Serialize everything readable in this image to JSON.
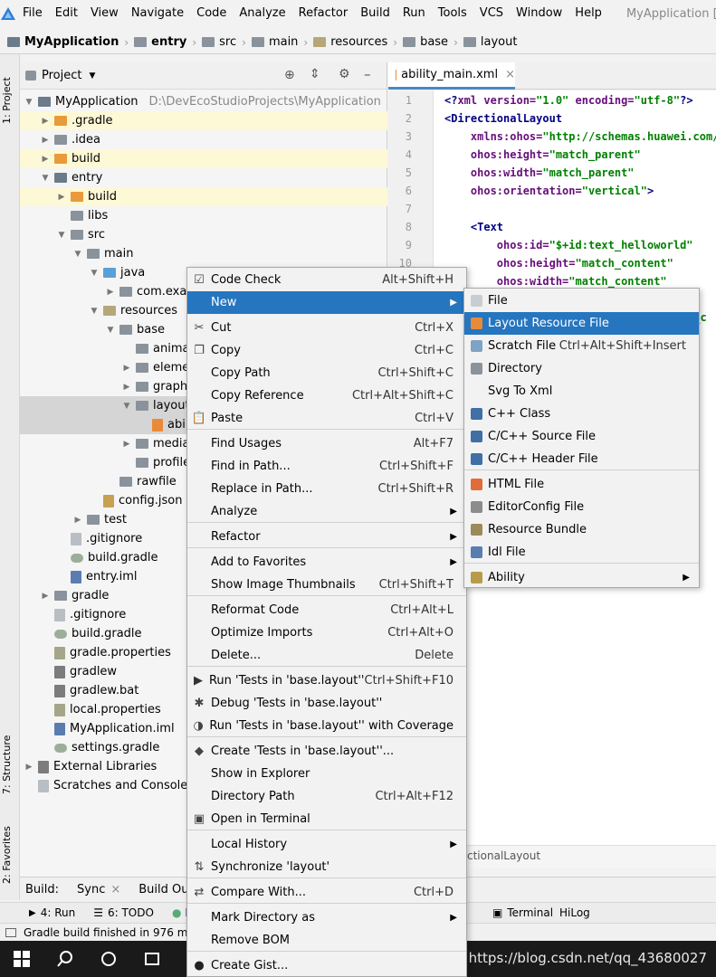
{
  "menubar": {
    "items": [
      "File",
      "Edit",
      "View",
      "Navigate",
      "Code",
      "Analyze",
      "Refactor",
      "Build",
      "Run",
      "Tools",
      "VCS",
      "Window",
      "Help"
    ],
    "window_title": "MyApplication ["
  },
  "breadcrumb": [
    "MyApplication",
    "entry",
    "src",
    "main",
    "resources",
    "base",
    "layout"
  ],
  "left_strip": {
    "project_tab": "1: Project",
    "structure_tab": "7: Structure",
    "favorites_tab": "2: Favorites"
  },
  "project_panel": {
    "title": "Project",
    "tree": [
      {
        "label": "MyApplication",
        "path": "D:\\DevEcoStudioProjects\\MyApplication"
      },
      {
        "label": ".gradle"
      },
      {
        "label": ".idea"
      },
      {
        "label": "build"
      },
      {
        "label": "entry"
      },
      {
        "label": "build"
      },
      {
        "label": "libs"
      },
      {
        "label": "src"
      },
      {
        "label": "main"
      },
      {
        "label": "java"
      },
      {
        "label": "com.exam"
      },
      {
        "label": "resources"
      },
      {
        "label": "base"
      },
      {
        "label": "animat"
      },
      {
        "label": "elemen"
      },
      {
        "label": "graphi"
      },
      {
        "label": "layout"
      },
      {
        "label": "abi"
      },
      {
        "label": "media"
      },
      {
        "label": "profile"
      },
      {
        "label": "rawfile"
      },
      {
        "label": "config.json"
      },
      {
        "label": "test"
      },
      {
        "label": ".gitignore"
      },
      {
        "label": "build.gradle"
      },
      {
        "label": "entry.iml"
      },
      {
        "label": "gradle"
      },
      {
        "label": ".gitignore"
      },
      {
        "label": "build.gradle"
      },
      {
        "label": "gradle.properties"
      },
      {
        "label": "gradlew"
      },
      {
        "label": "gradlew.bat"
      },
      {
        "label": "local.properties"
      },
      {
        "label": "MyApplication.iml"
      },
      {
        "label": "settings.gradle"
      },
      {
        "label": "External Libraries"
      },
      {
        "label": "Scratches and Consoles"
      }
    ]
  },
  "editor": {
    "tab": "ability_main.xml",
    "line_numbers": [
      "1",
      "2",
      "3",
      "4",
      "5",
      "6",
      "7",
      "8",
      "9",
      "10"
    ],
    "lines": [
      {
        "a": "<?",
        "b": "xml version=",
        "c": "\"1.0\"",
        "d": " encoding=",
        "e": "\"utf-8\"",
        "f": "?>"
      },
      {
        "a": "<DirectionalLayout",
        "b": "",
        "c": "",
        "d": "",
        "e": "",
        "f": ""
      },
      {
        "a": "    ",
        "b": "xmlns:ohos=",
        "c": "\"http://schemas.huawei.com/r",
        "d": "",
        "e": "",
        "f": ""
      },
      {
        "a": "    ",
        "b": "ohos:height=",
        "c": "\"match_parent\"",
        "d": "",
        "e": "",
        "f": ""
      },
      {
        "a": "    ",
        "b": "ohos:width=",
        "c": "\"match_parent\"",
        "d": "",
        "e": "",
        "f": ""
      },
      {
        "a": "    ",
        "b": "ohos:orientation=",
        "c": "\"vertical\"",
        "d": "",
        "e": "",
        "f": ">"
      },
      {
        "a": "",
        "b": "",
        "c": "",
        "d": "",
        "e": "",
        "f": ""
      },
      {
        "a": "    <Text",
        "b": "",
        "c": "",
        "d": "",
        "e": "",
        "f": ""
      },
      {
        "a": "        ",
        "b": "ohos:id=",
        "c": "\"$+id:text_helloworld\"",
        "d": "",
        "e": "",
        "f": ""
      },
      {
        "a": "        ",
        "b": "ohos:height=",
        "c": "\"match_content\"",
        "d": "",
        "e": "",
        "f": ""
      },
      {
        "a": "        ",
        "b": "ohos:width=",
        "c": "\"match_content\"",
        "d": "",
        "e": "",
        "f": ""
      }
    ],
    "partial_1": ":b",
    "partial_2": "l_c",
    "footer": "ctionalLayout"
  },
  "build_bar": {
    "label": "Build:",
    "sync": "Sync",
    "output": "Build Outp"
  },
  "bottom_bar": {
    "run": "4: Run",
    "todo": "6: TODO",
    "b": "B",
    "terminal": "Terminal",
    "hilog": "HiLog"
  },
  "status": "Gradle build finished in 976 ms",
  "watermark": "https://blog.csdn.net/qq_43680027",
  "context_menu": [
    {
      "label": "Code Check",
      "shortcut": "Alt+Shift+H"
    },
    {
      "label": "New",
      "shortcut": ""
    },
    {
      "label": "Cut",
      "shortcut": "Ctrl+X"
    },
    {
      "label": "Copy",
      "shortcut": "Ctrl+C"
    },
    {
      "label": "Copy Path",
      "shortcut": "Ctrl+Shift+C"
    },
    {
      "label": "Copy Reference",
      "shortcut": "Ctrl+Alt+Shift+C"
    },
    {
      "label": "Paste",
      "shortcut": "Ctrl+V"
    },
    {
      "label": "Find Usages",
      "shortcut": "Alt+F7"
    },
    {
      "label": "Find in Path...",
      "shortcut": "Ctrl+Shift+F"
    },
    {
      "label": "Replace in Path...",
      "shortcut": "Ctrl+Shift+R"
    },
    {
      "label": "Analyze",
      "shortcut": ""
    },
    {
      "label": "Refactor",
      "shortcut": ""
    },
    {
      "label": "Add to Favorites",
      "shortcut": ""
    },
    {
      "label": "Show Image Thumbnails",
      "shortcut": "Ctrl+Shift+T"
    },
    {
      "label": "Reformat Code",
      "shortcut": "Ctrl+Alt+L"
    },
    {
      "label": "Optimize Imports",
      "shortcut": "Ctrl+Alt+O"
    },
    {
      "label": "Delete...",
      "shortcut": "Delete"
    },
    {
      "label": "Run 'Tests in 'base.layout''",
      "shortcut": "Ctrl+Shift+F10"
    },
    {
      "label": "Debug 'Tests in 'base.layout''",
      "shortcut": ""
    },
    {
      "label": "Run 'Tests in 'base.layout'' with Coverage",
      "shortcut": ""
    },
    {
      "label": "Create 'Tests in 'base.layout''...",
      "shortcut": ""
    },
    {
      "label": "Show in Explorer",
      "shortcut": ""
    },
    {
      "label": "Directory Path",
      "shortcut": "Ctrl+Alt+F12"
    },
    {
      "label": "Open in Terminal",
      "shortcut": ""
    },
    {
      "label": "Local History",
      "shortcut": ""
    },
    {
      "label": "Synchronize 'layout'",
      "shortcut": ""
    },
    {
      "label": "Compare With...",
      "shortcut": "Ctrl+D"
    },
    {
      "label": "Mark Directory as",
      "shortcut": ""
    },
    {
      "label": "Remove BOM",
      "shortcut": ""
    },
    {
      "label": "Create Gist...",
      "shortcut": ""
    }
  ],
  "submenu": [
    {
      "label": "File",
      "shortcut": ""
    },
    {
      "label": "Layout Resource File",
      "shortcut": ""
    },
    {
      "label": "Scratch File",
      "shortcut": "Ctrl+Alt+Shift+Insert"
    },
    {
      "label": "Directory",
      "shortcut": ""
    },
    {
      "label": "Svg To Xml",
      "shortcut": ""
    },
    {
      "label": "C++ Class",
      "shortcut": ""
    },
    {
      "label": "C/C++ Source File",
      "shortcut": ""
    },
    {
      "label": "C/C++ Header File",
      "shortcut": ""
    },
    {
      "label": "HTML File",
      "shortcut": ""
    },
    {
      "label": "EditorConfig File",
      "shortcut": ""
    },
    {
      "label": "Resource Bundle",
      "shortcut": ""
    },
    {
      "label": "Idl File",
      "shortcut": ""
    },
    {
      "label": "Ability",
      "shortcut": ""
    }
  ],
  "colors": {
    "accent": "#2675bf",
    "tree_highlight": "#fdf8d6",
    "tab_underline": "#4a88c7"
  }
}
